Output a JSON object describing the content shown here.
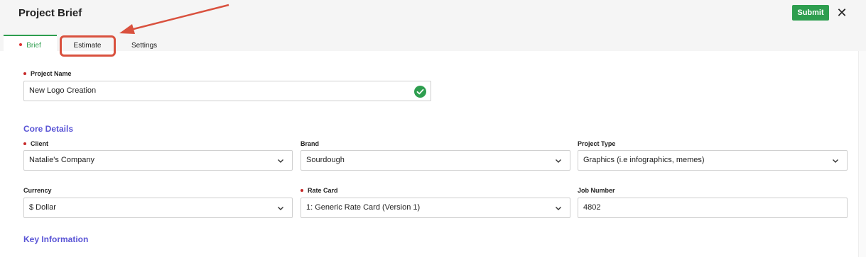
{
  "header": {
    "title": "Project Brief",
    "submit_label": "Submit",
    "close_glyph": "✕"
  },
  "tabs": [
    {
      "label": "Brief",
      "active": true,
      "required": true
    },
    {
      "label": "Estimate",
      "highlighted": true
    },
    {
      "label": "Settings"
    }
  ],
  "project_name": {
    "label": "Project Name",
    "value": "New Logo Creation",
    "valid": true
  },
  "core_details": {
    "heading": "Core Details",
    "client": {
      "label": "Client",
      "value": "Natalie's Company"
    },
    "brand": {
      "label": "Brand",
      "value": "Sourdough"
    },
    "project_type": {
      "label": "Project Type",
      "value": "Graphics (i.e infographics, memes)"
    },
    "currency": {
      "label": "Currency",
      "value": "$ Dollar"
    },
    "rate_card": {
      "label": "Rate Card",
      "value": "1: Generic Rate Card (Version 1)"
    },
    "job_number": {
      "label": "Job Number",
      "value": "4802"
    }
  },
  "key_information": {
    "heading": "Key Information"
  },
  "colors": {
    "accent_green": "#2e9e4f",
    "section_purple": "#5a55d6",
    "required_red": "#c62828",
    "annotation_red": "#d9513e"
  }
}
